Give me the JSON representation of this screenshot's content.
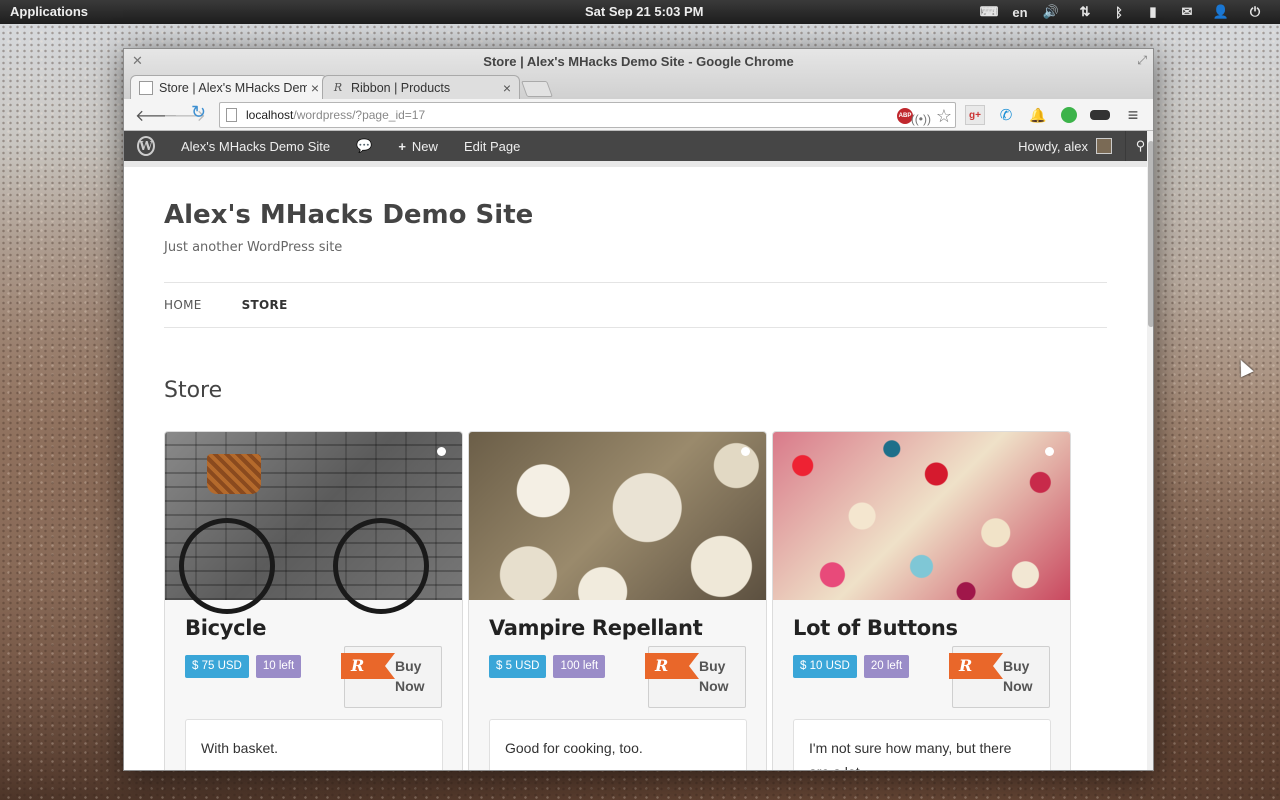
{
  "system": {
    "applications": "Applications",
    "clock": "Sat Sep 21  5:03 PM",
    "tray": {
      "keyboard_icon": "keyboard-icon",
      "language": "en",
      "icons": [
        "volume-icon",
        "network-icon",
        "bluetooth-icon",
        "battery-icon",
        "mail-icon",
        "user-icon",
        "power-icon"
      ]
    }
  },
  "browser": {
    "window_title": "Store | Alex's MHacks Demo Site - Google Chrome",
    "tabs": [
      {
        "label": "Store | Alex's MHacks Demo Site",
        "active": true
      },
      {
        "label": "Ribbon | Products",
        "active": false
      }
    ],
    "url_host": "localhost",
    "url_rest": "/wordpress/?page_id=17",
    "abp_label": "ABP"
  },
  "adminbar": {
    "site_name": "Alex's MHacks Demo Site",
    "new_label": "New",
    "edit_label": "Edit Page",
    "howdy": "Howdy, alex"
  },
  "site": {
    "title": "Alex's MHacks Demo Site",
    "tagline": "Just another WordPress site",
    "nav": [
      {
        "label": "HOME",
        "active": false
      },
      {
        "label": "STORE",
        "active": true
      }
    ],
    "page_heading": "Store"
  },
  "products": [
    {
      "name": "Bicycle",
      "price": "$ 75 USD",
      "stock": "10 left",
      "buy_line1": "Buy",
      "buy_line2": "Now",
      "description": "With basket."
    },
    {
      "name": "Vampire Repellant",
      "price": "$ 5 USD",
      "stock": "100 left",
      "buy_line1": "Buy",
      "buy_line2": "Now",
      "description": "Good for cooking, too."
    },
    {
      "name": "Lot of Buttons",
      "price": "$ 10 USD",
      "stock": "20 left",
      "buy_line1": "Buy",
      "buy_line2": "Now",
      "description": "I'm not sure how many, but there are a lot."
    }
  ],
  "colors": {
    "price_pill": "#3aa6d8",
    "stock_pill": "#9a8cc8",
    "ribbon_orange": "#e9672a",
    "admin_bar": "#464646"
  }
}
